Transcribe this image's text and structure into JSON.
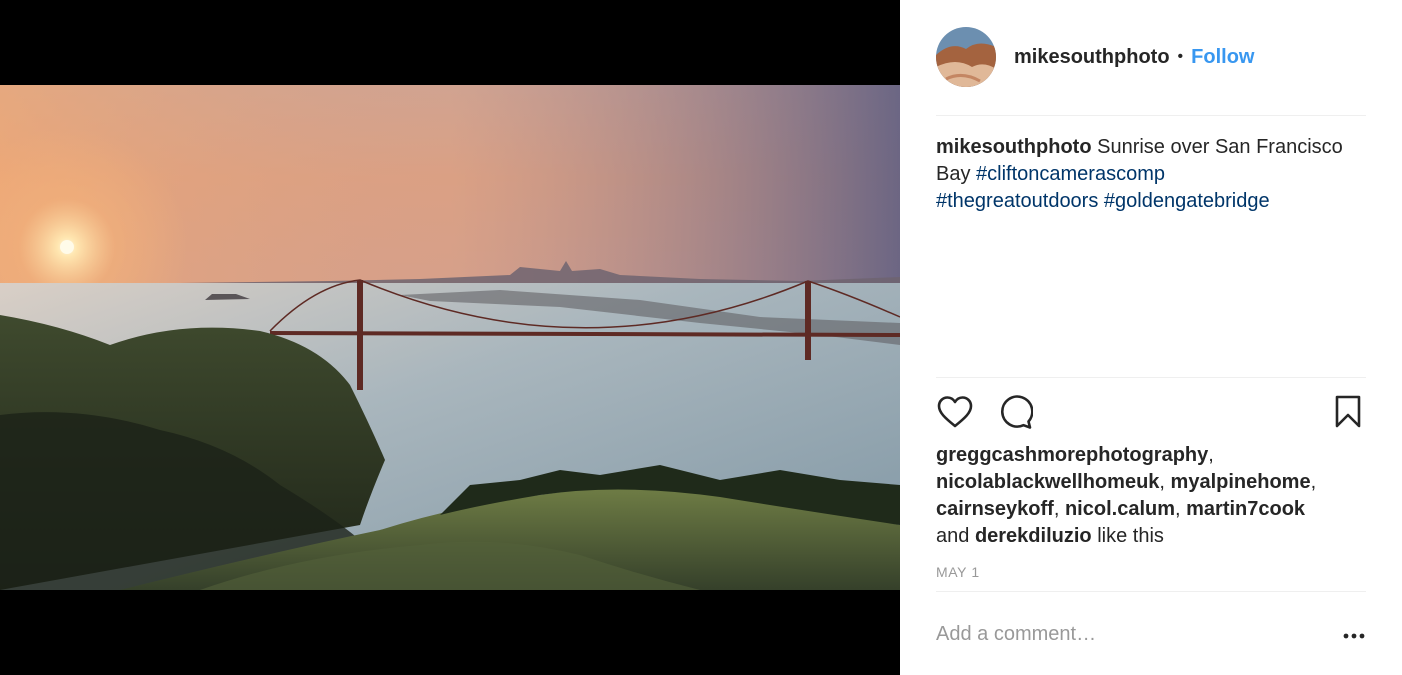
{
  "post": {
    "author": "mikesouthphoto",
    "separator": "•",
    "follow_label": "Follow",
    "caption": {
      "username": "mikesouthphoto",
      "text": "Sunrise over San Francisco Bay",
      "hashtags": [
        "#cliftoncamerascomp",
        "#thegreatoutdoors",
        "#goldengatebridge"
      ]
    },
    "likes": {
      "users": [
        "greggcashmorephotography",
        "nicolablackwellhomeuk",
        "myalpinehome",
        "cairnseykoff",
        "nicol.calum",
        "martin7cook"
      ],
      "and_text": "and",
      "last_user": "derekdiluzio",
      "suffix": "like this"
    },
    "date": "MAY 1",
    "comment_placeholder": "Add a comment…"
  },
  "icons": {
    "like": "heart-icon",
    "comment": "comment-bubble-icon",
    "save": "bookmark-icon",
    "more": "more-options-icon"
  },
  "colors": {
    "follow": "#3897f0",
    "hashtag": "#003569",
    "text": "#262626",
    "muted": "#999999",
    "divider": "#efefef"
  }
}
